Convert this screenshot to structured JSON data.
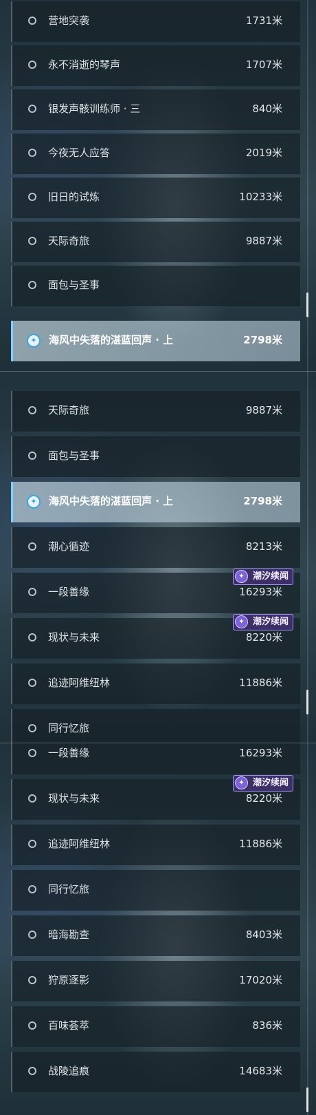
{
  "quest_tag": {
    "label": "潮汐续闻",
    "icon": "tide-sparkle-icon",
    "color": "#3b2f66"
  },
  "accent_color": "#7fd2ff",
  "panels": [
    {
      "items": [
        {
          "name": "营地突袭",
          "distance": "1731米"
        },
        {
          "name": "永不消逝的琴声",
          "distance": "1707米"
        },
        {
          "name": "银发声骸训练师 · 三",
          "distance": "840米"
        },
        {
          "name": "今夜无人应答",
          "distance": "2019米"
        },
        {
          "name": "旧日的试炼",
          "distance": "10233米"
        },
        {
          "name": "天际奇旅",
          "distance": "9887米"
        },
        {
          "name": "面包与圣事",
          "distance": ""
        },
        {
          "name": "海风中失落的湛蓝回声 · 上",
          "distance": "2798米",
          "selected": true
        }
      ]
    },
    {
      "items": [
        {
          "name": "天际奇旅",
          "distance": "9887米"
        },
        {
          "name": "面包与圣事",
          "distance": ""
        },
        {
          "name": "海风中失落的湛蓝回声 · 上",
          "distance": "2798米",
          "selected": true
        },
        {
          "name": "潮心循迹",
          "distance": "8213米"
        },
        {
          "name": "一段善缘",
          "distance": "16293米",
          "tag": true
        },
        {
          "name": "现状与未来",
          "distance": "8220米",
          "tag": true
        },
        {
          "name": "追迹阿维纽林",
          "distance": "11886米"
        },
        {
          "name": "同行忆旅",
          "distance": ""
        }
      ]
    },
    {
      "items": [
        {
          "name": "一段善缘",
          "distance": "16293米"
        },
        {
          "name": "现状与未来",
          "distance": "8220米",
          "tag": true
        },
        {
          "name": "追迹阿维纽林",
          "distance": "11886米"
        },
        {
          "name": "同行忆旅",
          "distance": ""
        },
        {
          "name": "暗海勘查",
          "distance": "8403米"
        },
        {
          "name": "狩原逐影",
          "distance": "17020米"
        },
        {
          "name": "百味荟萃",
          "distance": "836米"
        },
        {
          "name": "战陵追痕",
          "distance": "14683米"
        }
      ]
    }
  ]
}
